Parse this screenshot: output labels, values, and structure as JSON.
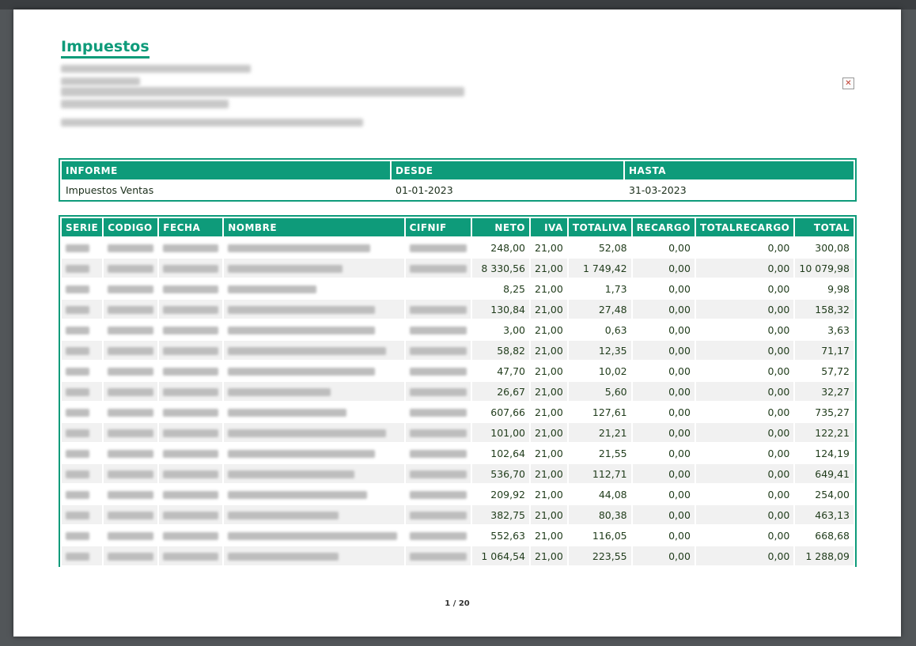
{
  "document": {
    "title": "Impuestos",
    "page_indicator": "1 / 20"
  },
  "info_table": {
    "headers": [
      "INFORME",
      "DESDE",
      "HASTA"
    ],
    "values": [
      "Impuestos Ventas",
      "01-01-2023",
      "31-03-2023"
    ]
  },
  "data_table": {
    "headers": [
      "SERIE",
      "CODIGO",
      "FECHA",
      "NOMBRE",
      "CIFNIF",
      "NETO",
      "IVA",
      "TOTALIVA",
      "RECARGO",
      "TOTALRECARGO",
      "TOTAL"
    ],
    "rows": [
      {
        "neto": "248,00",
        "iva": "21,00",
        "totaliva": "52,08",
        "recargo": "0,00",
        "totalrecargo": "0,00",
        "total": "300,08"
      },
      {
        "neto": "8 330,56",
        "iva": "21,00",
        "totaliva": "1 749,42",
        "recargo": "0,00",
        "totalrecargo": "0,00",
        "total": "10 079,98"
      },
      {
        "neto": "8,25",
        "iva": "21,00",
        "totaliva": "1,73",
        "recargo": "0,00",
        "totalrecargo": "0,00",
        "total": "9,98"
      },
      {
        "neto": "130,84",
        "iva": "21,00",
        "totaliva": "27,48",
        "recargo": "0,00",
        "totalrecargo": "0,00",
        "total": "158,32"
      },
      {
        "neto": "3,00",
        "iva": "21,00",
        "totaliva": "0,63",
        "recargo": "0,00",
        "totalrecargo": "0,00",
        "total": "3,63"
      },
      {
        "neto": "58,82",
        "iva": "21,00",
        "totaliva": "12,35",
        "recargo": "0,00",
        "totalrecargo": "0,00",
        "total": "71,17"
      },
      {
        "neto": "47,70",
        "iva": "21,00",
        "totaliva": "10,02",
        "recargo": "0,00",
        "totalrecargo": "0,00",
        "total": "57,72"
      },
      {
        "neto": "26,67",
        "iva": "21,00",
        "totaliva": "5,60",
        "recargo": "0,00",
        "totalrecargo": "0,00",
        "total": "32,27"
      },
      {
        "neto": "607,66",
        "iva": "21,00",
        "totaliva": "127,61",
        "recargo": "0,00",
        "totalrecargo": "0,00",
        "total": "735,27"
      },
      {
        "neto": "101,00",
        "iva": "21,00",
        "totaliva": "21,21",
        "recargo": "0,00",
        "totalrecargo": "0,00",
        "total": "122,21"
      },
      {
        "neto": "102,64",
        "iva": "21,00",
        "totaliva": "21,55",
        "recargo": "0,00",
        "totalrecargo": "0,00",
        "total": "124,19"
      },
      {
        "neto": "536,70",
        "iva": "21,00",
        "totaliva": "112,71",
        "recargo": "0,00",
        "totalrecargo": "0,00",
        "total": "649,41"
      },
      {
        "neto": "209,92",
        "iva": "21,00",
        "totaliva": "44,08",
        "recargo": "0,00",
        "totalrecargo": "0,00",
        "total": "254,00"
      },
      {
        "neto": "382,75",
        "iva": "21,00",
        "totaliva": "80,38",
        "recargo": "0,00",
        "totalrecargo": "0,00",
        "total": "463,13"
      },
      {
        "neto": "552,63",
        "iva": "21,00",
        "totaliva": "116,05",
        "recargo": "0,00",
        "totalrecargo": "0,00",
        "total": "668,68"
      },
      {
        "neto": "1 064,54",
        "iva": "21,00",
        "totaliva": "223,55",
        "recargo": "0,00",
        "totalrecargo": "0,00",
        "total": "1 288,09"
      }
    ]
  },
  "colors": {
    "accent": "#0e9b7a",
    "viewer_background": "#525659"
  }
}
